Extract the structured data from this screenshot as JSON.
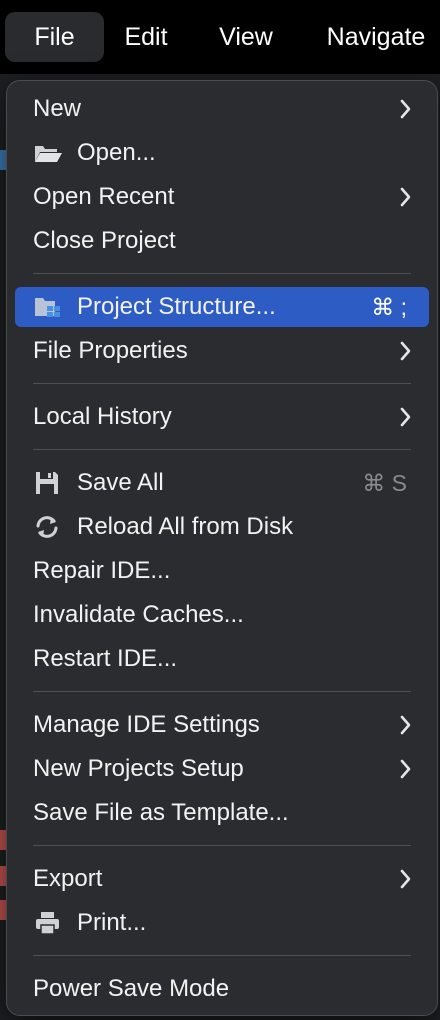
{
  "menubar": {
    "items": [
      {
        "label": "File"
      },
      {
        "label": "Edit"
      },
      {
        "label": "View"
      },
      {
        "label": "Navigate"
      }
    ]
  },
  "file_menu": {
    "new": "New",
    "open": "Open...",
    "open_recent": "Open Recent",
    "close_project": "Close Project",
    "project_structure": "Project Structure...",
    "project_structure_shortcut": "⌘ ;",
    "file_properties": "File Properties",
    "local_history": "Local History",
    "save_all": "Save All",
    "save_all_shortcut": "⌘ S",
    "reload_all": "Reload All from Disk",
    "repair_ide": "Repair IDE...",
    "invalidate_caches": "Invalidate Caches...",
    "restart_ide": "Restart IDE...",
    "manage_ide_settings": "Manage IDE Settings",
    "new_projects_setup": "New Projects Setup",
    "save_file_as_template": "Save File as Template...",
    "export": "Export",
    "print": "Print...",
    "power_save_mode": "Power Save Mode"
  },
  "colors": {
    "selection": "#2e5cc5",
    "menu_bg": "#2b2c2f",
    "menubar_bg": "#000000",
    "text": "#f2f2f2"
  }
}
